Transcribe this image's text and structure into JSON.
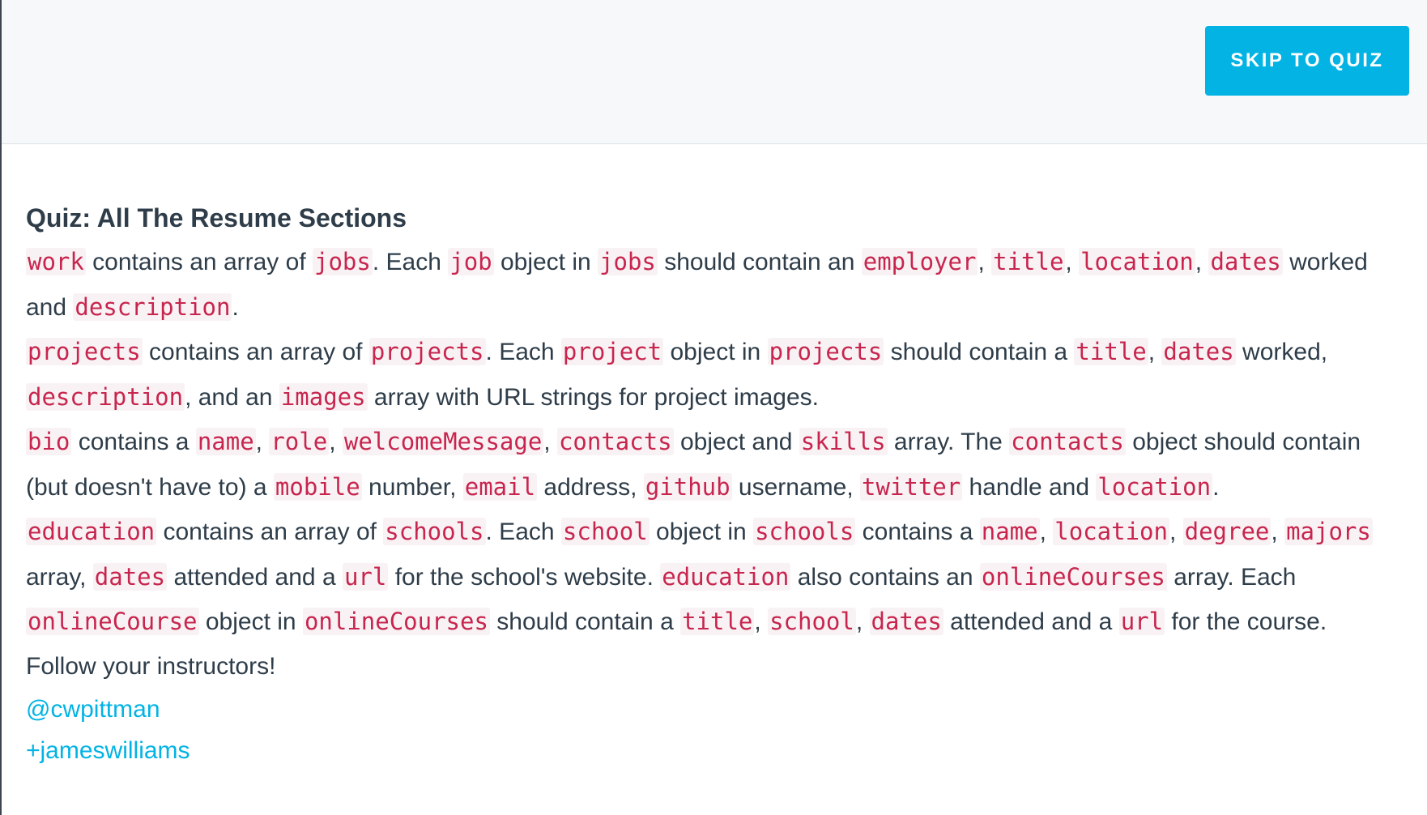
{
  "header": {
    "skip_button_label": "SKIP TO QUIZ"
  },
  "quiz": {
    "title": "Quiz: All The Resume Sections",
    "work": {
      "c1": "work",
      "t1": " contains an array of ",
      "c2": "jobs",
      "t2": ". Each ",
      "c3": "job",
      "t3": " object in ",
      "c4": "jobs",
      "t4": " should contain an ",
      "c5": "employer",
      "t5": ", ",
      "c6": "title",
      "t6": ", ",
      "c7": "location",
      "t7": ", ",
      "c8": "dates",
      "t8": " worked and ",
      "c9": "description",
      "t9": "."
    },
    "projects": {
      "c1": "projects",
      "t1": " contains an array of ",
      "c2": "projects",
      "t2": ". Each ",
      "c3": "project",
      "t3": " object in ",
      "c4": "projects",
      "t4": " should contain a ",
      "c5": "title",
      "t5": ", ",
      "c6": "dates",
      "t6": " worked, ",
      "c7": "description",
      "t7": ", and an ",
      "c8": "images",
      "t8": " array with URL strings for project images."
    },
    "bio": {
      "c1": "bio",
      "t1": " contains a ",
      "c2": "name",
      "t2": ", ",
      "c3": "role",
      "t3": ", ",
      "c4": "welcomeMessage",
      "t4": ", ",
      "c5": "contacts",
      "t5": " object and ",
      "c6": "skills",
      "t6": " array. The ",
      "c7": "contacts",
      "t7": " object should contain (but doesn't have to) a ",
      "c8": "mobile",
      "t8": " number, ",
      "c9": "email",
      "t9": " address, ",
      "c10": "github",
      "t10": " username, ",
      "c11": "twitter",
      "t11": " handle and ",
      "c12": "location",
      "t12": "."
    },
    "education": {
      "c1": "education",
      "t1": " contains an array of ",
      "c2": "schools",
      "t2": ". Each ",
      "c3": "school",
      "t3": " object in ",
      "c4": "schools",
      "t4": " contains a ",
      "c5": "name",
      "t5": ", ",
      "c6": "location",
      "t6": ", ",
      "c7": "degree",
      "t7": ", ",
      "c8": "majors",
      "t8": " array, ",
      "c9": "dates",
      "t9": " attended and a ",
      "c10": "url",
      "t10": " for the school's website. ",
      "c11": "education",
      "t11": " also contains an ",
      "c12": "onlineCourses",
      "t12": " array. Each ",
      "c13": "onlineCourse",
      "t13": " object in ",
      "c14": "onlineCourses",
      "t14": " should contain a ",
      "c15": "title",
      "t15": ", ",
      "c16": "school",
      "t16": ", ",
      "c17": "dates",
      "t17": " attended and a ",
      "c18": "url",
      "t18": " for the course."
    },
    "follow_text": "Follow your instructors!",
    "instructors": [
      "@cwpittman",
      "+jameswilliams"
    ]
  },
  "colors": {
    "accent": "#02b3e4",
    "code_text": "#c7254e",
    "code_background": "#f9f2f4",
    "body_text": "#2e3d49",
    "header_background": "#f7f8fa"
  }
}
